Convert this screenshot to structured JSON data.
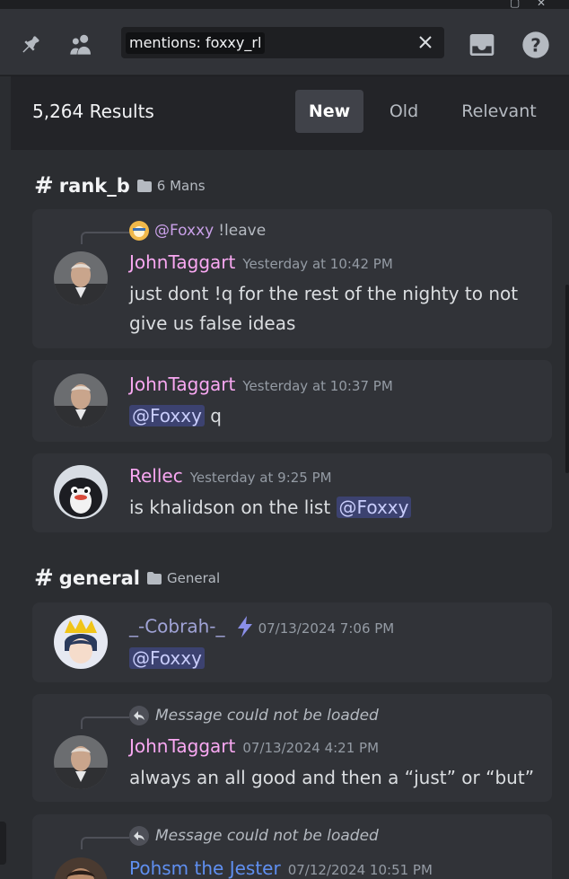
{
  "toolbar": {
    "search_query": "mentions: foxxy_rl"
  },
  "results": {
    "count_label": "5,264 Results",
    "sort_tabs": [
      {
        "label": "New",
        "active": true
      },
      {
        "label": "Old",
        "active": false
      },
      {
        "label": "Relevant",
        "active": false
      }
    ]
  },
  "groups": [
    {
      "hash": "#",
      "channel": "rank_b",
      "category": "6 Mans",
      "messages": [
        {
          "reply_mention": "@Foxxy",
          "reply_text": "!leave",
          "author": "JohnTaggart",
          "timestamp": "Yesterday at 10:42 PM",
          "content_line1": "just dont !q for the rest of the nighty to not",
          "content_line2": "give us false ideas"
        },
        {
          "author": "JohnTaggart",
          "timestamp": "Yesterday at 10:37 PM",
          "mention": "@Foxxy",
          "content": "q"
        },
        {
          "author": "Rellec",
          "timestamp": "Yesterday at 9:25 PM",
          "content": "is khalidson on the list",
          "mention": "@Foxxy"
        }
      ]
    },
    {
      "hash": "#",
      "channel": "general",
      "category": "General",
      "messages": [
        {
          "author": "_-Cobrah-_",
          "timestamp": "07/13/2024 7:06 PM",
          "mention": "@Foxxy"
        },
        {
          "reply_text": "Message could not be loaded",
          "author": "JohnTaggart",
          "timestamp": "07/13/2024 4:21 PM",
          "content": "always an all good and then a “just” or “but”"
        },
        {
          "reply_text": "Message could not be loaded",
          "author": "Pohsm the Jester",
          "timestamp": "07/12/2024 10:51 PM"
        }
      ]
    }
  ],
  "colors": {
    "panel_bg": "#2b2d31",
    "card_bg": "#313338",
    "author_pink": "#f9a8f2",
    "author_blue": "#5f8ff0",
    "mention_bg": "#3c4270",
    "mention_text": "#c9cdfb"
  },
  "icons": [
    "pin-icon",
    "members-icon",
    "close-icon",
    "inbox-icon",
    "help-icon",
    "folder-icon",
    "reply-arrow-icon",
    "lightning-icon"
  ]
}
